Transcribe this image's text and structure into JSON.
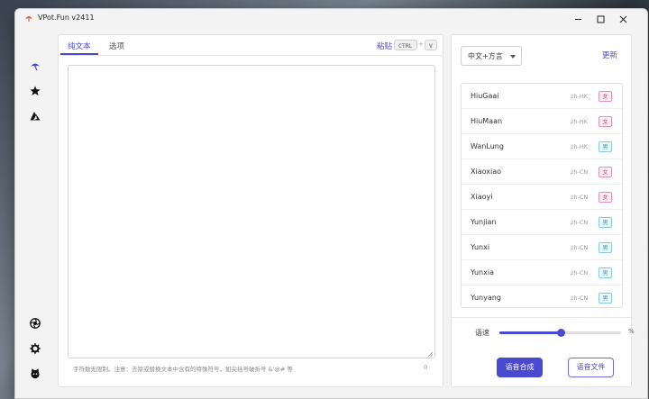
{
  "window": {
    "title": "VPot.Fun v2411"
  },
  "tabs": [
    {
      "label": "纯文本"
    },
    {
      "label": "选项"
    }
  ],
  "paste": {
    "label": "粘贴",
    "key1": "CTRL",
    "plus": "+",
    "key2": "V"
  },
  "editor": {
    "hint": "字符数无限制。注意：去除或替换文本中含有的特殊符号，如尖括号破折号 &'@# 等",
    "count": "0"
  },
  "language": {
    "selected": "中文+方言"
  },
  "refresh_label": "更新",
  "voices": [
    {
      "name": "HiuGaai",
      "locale": "zh-HK",
      "gender": "女"
    },
    {
      "name": "HiuMaan",
      "locale": "zh-HK",
      "gender": "女"
    },
    {
      "name": "WanLung",
      "locale": "zh-HK",
      "gender": "男"
    },
    {
      "name": "Xiaoxiao",
      "locale": "zh-CN",
      "gender": "女"
    },
    {
      "name": "Xiaoyi",
      "locale": "zh-CN",
      "gender": "女"
    },
    {
      "name": "Yunjian",
      "locale": "zh-CN",
      "gender": "男"
    },
    {
      "name": "Yunxi",
      "locale": "zh-CN",
      "gender": "男"
    },
    {
      "name": "Yunxia",
      "locale": "zh-CN",
      "gender": "男"
    },
    {
      "name": "Yunyang",
      "locale": "zh-CN",
      "gender": "男"
    }
  ],
  "speed": {
    "label": "语速",
    "unit": "%",
    "level_fraction": 0.51
  },
  "actions": {
    "synthesize": "语音合成",
    "file": "语音文件"
  },
  "colors": {
    "accent": "#4a4ad0",
    "female": "#d94b7f",
    "male": "#23a3c8"
  },
  "icons": {
    "app": "umbrella-icon",
    "sidebar_top": [
      "umbrella-icon",
      "star-icon",
      "azure-icon"
    ],
    "sidebar_bottom": [
      "aperture-icon",
      "gear-icon",
      "github-icon"
    ]
  }
}
